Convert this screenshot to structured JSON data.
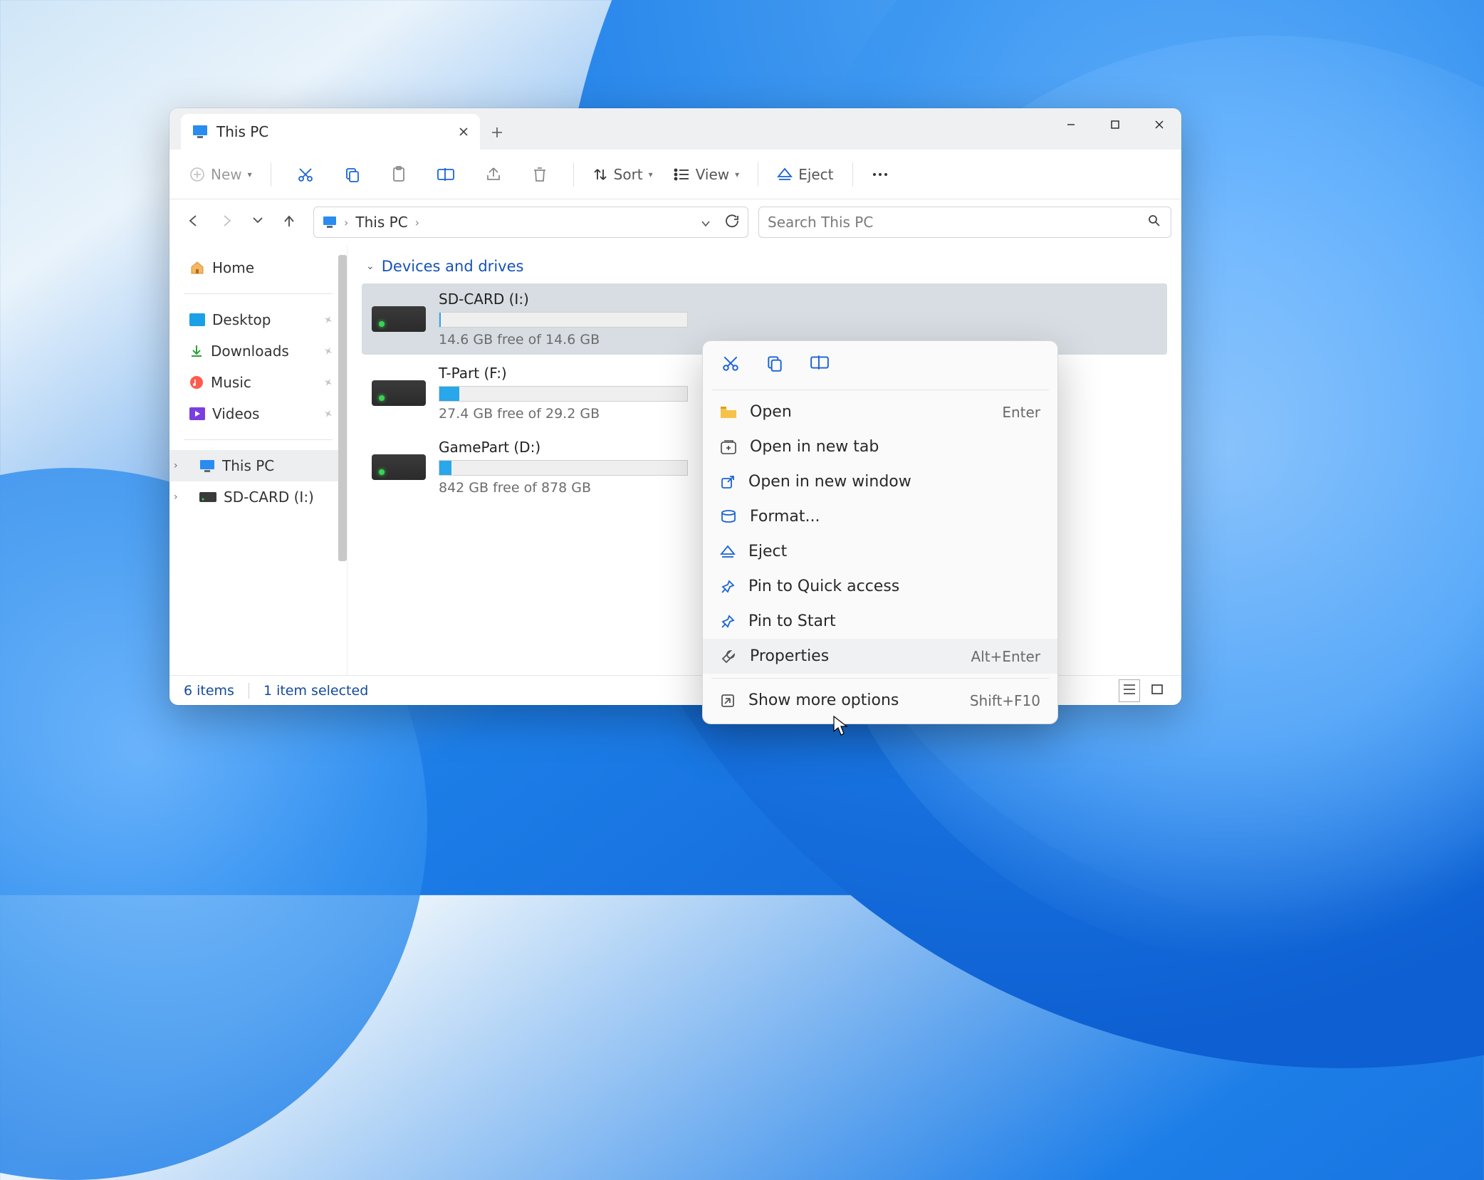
{
  "titlebar": {
    "tab_label": "This PC"
  },
  "toolbar": {
    "new_label": "New",
    "sort_label": "Sort",
    "view_label": "View",
    "eject_label": "Eject"
  },
  "breadcrumbs": {
    "root": "This PC"
  },
  "search": {
    "placeholder": "Search This PC"
  },
  "sidebar": {
    "home": "Home",
    "desktop": "Desktop",
    "downloads": "Downloads",
    "music": "Music",
    "videos": "Videos",
    "thispc": "This PC",
    "sdcard": "SD-CARD (I:)"
  },
  "group_header": "Devices and drives",
  "drives": [
    {
      "label": "SD-CARD (I:)",
      "sub": "14.6 GB free of 14.6 GB",
      "fill_pct": 0.5,
      "selected": true
    },
    {
      "label": "T-Part (F:)",
      "sub": "27.4 GB free of 29.2 GB",
      "fill_pct": 8,
      "selected": false
    },
    {
      "label": "GamePart (D:)",
      "sub": "842 GB free of 878 GB",
      "fill_pct": 5,
      "selected": false
    }
  ],
  "statusbar": {
    "count": "6 items",
    "selected": "1 item selected"
  },
  "context_menu": {
    "open": {
      "label": "Open",
      "kbd": "Enter"
    },
    "open_tab": {
      "label": "Open in new tab"
    },
    "open_win": {
      "label": "Open in new window"
    },
    "format": {
      "label": "Format..."
    },
    "eject": {
      "label": "Eject"
    },
    "pin_quick": {
      "label": "Pin to Quick access"
    },
    "pin_start": {
      "label": "Pin to Start"
    },
    "properties": {
      "label": "Properties",
      "kbd": "Alt+Enter"
    },
    "more": {
      "label": "Show more options",
      "kbd": "Shift+F10"
    }
  }
}
